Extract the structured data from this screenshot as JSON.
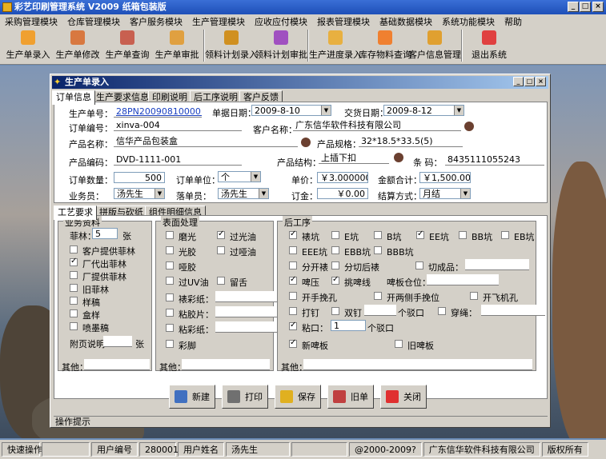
{
  "app": {
    "title": "彩艺印刷管理系统  V2009 纸箱包装版"
  },
  "menu": [
    "采购管理模块",
    "仓库管理模块",
    "客户服务模块",
    "生产管理模块",
    "应收应付模块",
    "报表管理模块",
    "基础数据模块",
    "系统功能模块",
    "帮助"
  ],
  "toolbar": [
    {
      "label": "生产单录入",
      "icon": "box-icon",
      "color": "#f0a030"
    },
    {
      "label": "生产单修改",
      "icon": "edit-box-icon",
      "color": "#d87840"
    },
    {
      "label": "生产单查询",
      "icon": "search-box-icon",
      "color": "#c86050"
    },
    {
      "label": "生产单审批",
      "icon": "approve-icon",
      "color": "#e0a040"
    },
    {
      "label": "领料计划录入",
      "icon": "material-icon",
      "color": "#d09020"
    },
    {
      "label": "领料计划审批",
      "icon": "blocks-icon",
      "color": "#a050c0"
    },
    {
      "label": "生产进度录入",
      "icon": "progress-icon",
      "color": "#e8b040"
    },
    {
      "label": "库存物料查询",
      "icon": "stock-icon",
      "color": "#f08030"
    },
    {
      "label": "客户信息管理",
      "icon": "customer-icon",
      "color": "#e0a030"
    },
    {
      "label": "退出系统",
      "icon": "exit-icon",
      "color": "#e04040"
    }
  ],
  "window": {
    "title": "生产单录入"
  },
  "tabs": [
    "订单信息",
    "生产要求信息",
    "印刷说明",
    "后工序说明",
    "客户反馈"
  ],
  "order": {
    "prod_no_label": "生产单号：",
    "prod_no": "28PN200908100001",
    "date_label": "单据日期：",
    "date": "2009-8-10",
    "delivery_label": "交货日期：",
    "delivery": "2009-8-12",
    "order_no_label": "订单编号：",
    "order_no": "xinva-004",
    "customer_label": "客户名称：",
    "customer": "广东信华软件科技有限公司",
    "product_label": "产品名称：",
    "product": "信华产品包装盒",
    "spec_label": "产品规格：",
    "spec": "32*18.5*33.5(5)",
    "code_label": "产品编码：",
    "code": "DVD-1111-001",
    "struct_label": "产品结构：",
    "struct": "上插下扣",
    "barcode_label": "条  码：",
    "barcode": "8435111055243",
    "qty_label": "订单数量：",
    "qty": "500",
    "unit_label": "订单单位：",
    "unit": "个",
    "price_label": "单价：",
    "price": "￥3.000000",
    "amount_label": "金额合计：",
    "amount": "￥1,500.00",
    "sales_label": "业务员：",
    "sales": "汤先生",
    "maker_label": "落单员：",
    "maker": "汤先生",
    "deposit_label": "订金：",
    "deposit": "￥0.00",
    "settle_label": "结算方式：",
    "settle": "月结"
  },
  "subtabs": [
    "工艺要求",
    "拼版与砍纸",
    "组件明细信息"
  ],
  "business": {
    "title": "业务资料",
    "sheets_label": "菲林：",
    "sheets": "5",
    "sheets_unit": "张",
    "items": [
      {
        "label": "客户提供菲林",
        "checked": false
      },
      {
        "label": "厂代出菲林",
        "checked": true
      },
      {
        "label": "厂提供菲林",
        "checked": false
      },
      {
        "label": "旧菲林",
        "checked": false
      },
      {
        "label": "样稿",
        "checked": false
      },
      {
        "label": "盒样",
        "checked": false
      },
      {
        "label": "喷墨稿",
        "checked": false
      }
    ],
    "attach_label": "附页说明",
    "attach_unit": "张",
    "other_label": "其他："
  },
  "surface": {
    "title": "表面处理",
    "grid": [
      {
        "label": "磨光",
        "checked": false
      },
      {
        "label": "过光油",
        "checked": true
      },
      {
        "label": "光胶",
        "checked": false
      },
      {
        "label": "过哑油",
        "checked": false
      },
      {
        "label": "哑胶",
        "checked": false
      }
    ],
    "row_uv": [
      {
        "label": "过UV油",
        "checked": false
      },
      {
        "label": "留舌",
        "checked": false
      }
    ],
    "fields": [
      {
        "label": "裱彩纸：",
        "checked": false
      },
      {
        "label": "粘胶片：",
        "checked": false
      },
      {
        "label": "粘彩纸：",
        "checked": false
      }
    ],
    "last": {
      "label": "彩脚",
      "checked": false
    },
    "other_label": "其他："
  },
  "post": {
    "title": "后工序",
    "flutes": [
      {
        "label": "裱坑",
        "checked": true
      },
      {
        "label": "E坑",
        "checked": false
      },
      {
        "label": "B坑",
        "checked": false
      },
      {
        "label": "EE坑",
        "checked": true
      },
      {
        "label": "BB坑",
        "checked": false
      },
      {
        "label": "EB坑",
        "checked": false
      }
    ],
    "flutes2": [
      {
        "label": "EEE坑",
        "checked": false
      },
      {
        "label": "EBB坑",
        "checked": false
      },
      {
        "label": "BBB坑",
        "checked": false
      }
    ],
    "row3": [
      {
        "label": "分开裱",
        "checked": false
      },
      {
        "label": "分切后裱",
        "checked": false
      },
      {
        "label": "切成品：",
        "checked": false
      }
    ],
    "row4": [
      {
        "label": "啤压",
        "checked": true
      },
      {
        "label": "挑啤线",
        "checked": true
      }
    ],
    "die_label": "啤板仓位：",
    "row5": [
      {
        "label": "开手挽孔",
        "checked": false
      },
      {
        "label": "开两侧手挽位",
        "checked": false
      },
      {
        "label": "开飞机孔",
        "checked": false
      }
    ],
    "row6": [
      {
        "label": "打钉",
        "checked": false
      },
      {
        "label": "双钉",
        "checked": false
      },
      {
        "label": "穿绳：",
        "checked": false
      }
    ],
    "nail_unit": "个驳口",
    "glue": {
      "label": "粘口：",
      "checked": true,
      "value": "1",
      "unit": "个驳口"
    },
    "row8": [
      {
        "label": "新啤板",
        "checked": true
      },
      {
        "label": "旧啤板",
        "checked": false
      }
    ],
    "other_label": "其他："
  },
  "buttons": [
    {
      "label": "新建",
      "name": "new-button",
      "icon": "new-doc-icon",
      "color": "#4070c0"
    },
    {
      "label": "打印",
      "name": "print-button",
      "icon": "printer-icon",
      "color": "#707070"
    },
    {
      "label": "保存",
      "name": "save-button",
      "icon": "save-icon",
      "color": "#e0b020"
    },
    {
      "label": "旧单",
      "name": "old-order-button",
      "icon": "old-order-icon",
      "color": "#c04040"
    },
    {
      "label": "关闭",
      "name": "close-button",
      "icon": "close-icon",
      "color": "#e03030"
    }
  ],
  "hint": "操作提示",
  "status": {
    "quick": "快速操作",
    "user_no_label": "用户编号",
    "user_no": "280001",
    "user_name_label": "用户姓名",
    "user_name": "汤先生",
    "copyright": "@2000-2009?",
    "company": "广东信华软件科技有限公司",
    "rights": "版权所有"
  }
}
